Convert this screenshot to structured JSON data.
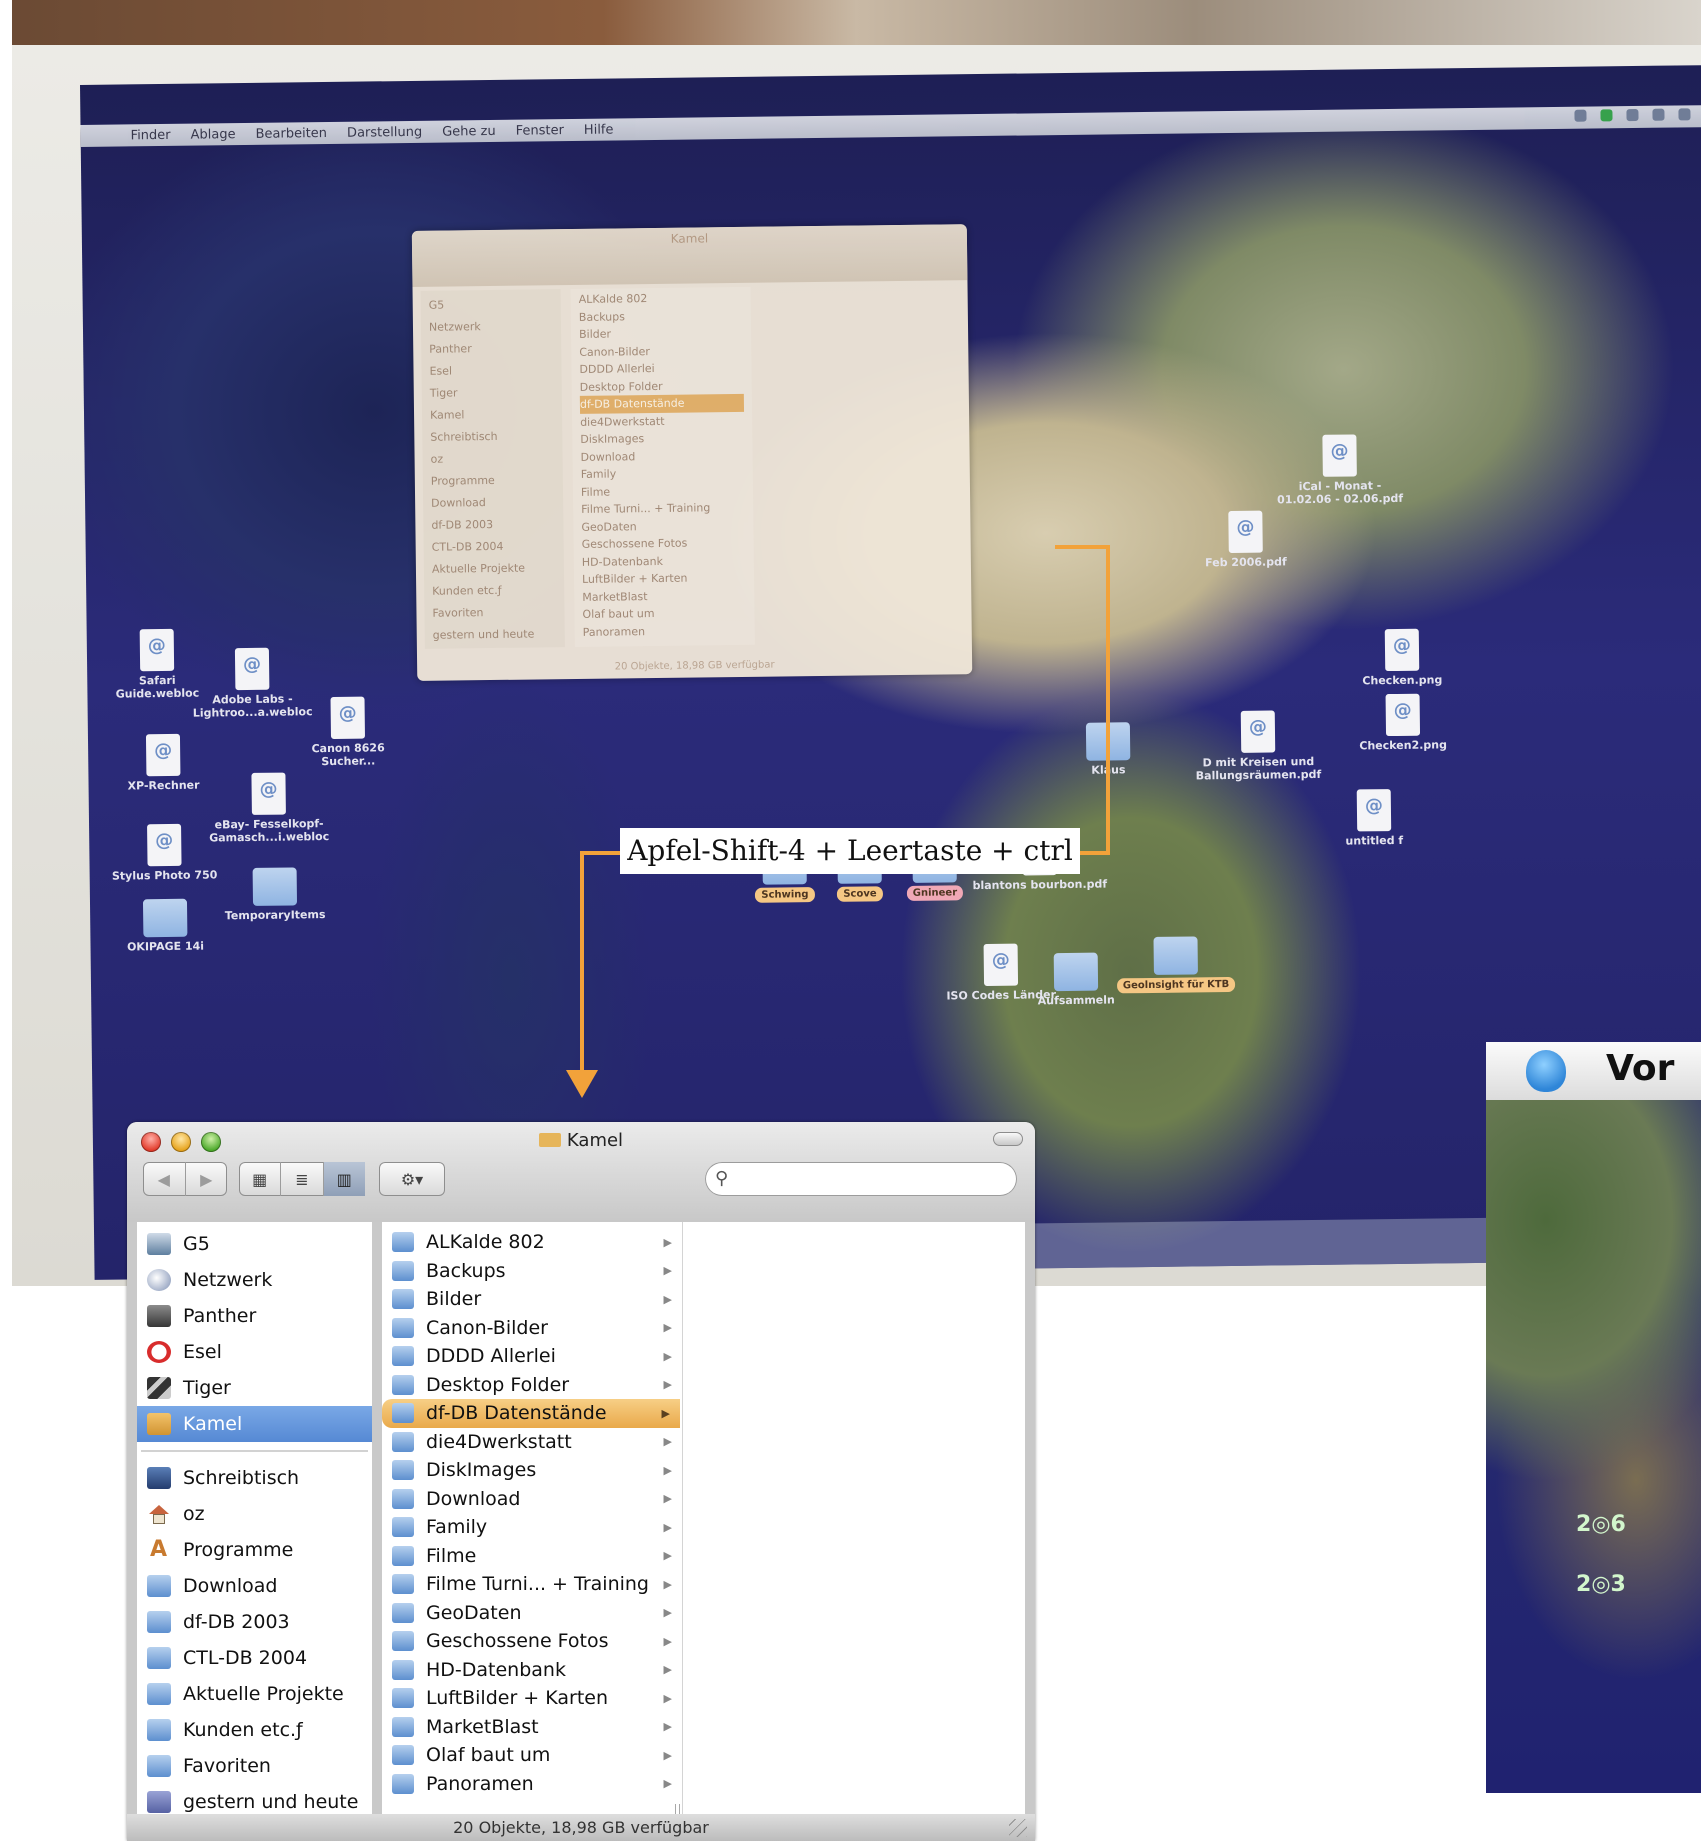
{
  "photo": {
    "menubar": [
      "Finder",
      "Ablage",
      "Bearbeiten",
      "Darstellung",
      "Gehe zu",
      "Fenster",
      "Hilfe"
    ],
    "faint_window_title": "Kamel",
    "faint_status": "20 Objekte, 18,98 GB verfügbar",
    "desktop_icons": [
      {
        "label": "Safari Guide.webloc"
      },
      {
        "label": "Adobe Labs - Lightroo...a.webloc"
      },
      {
        "label": "XP-Rechner"
      },
      {
        "label": "eBay- Fesselkopf-Gamasch...i.webloc"
      },
      {
        "label": "Stylus Photo 750"
      },
      {
        "label": "TemporaryItems"
      },
      {
        "label": "OKIPAGE 14i"
      },
      {
        "label": "Canon 8626 Sucher..."
      },
      {
        "label": "Klaus"
      },
      {
        "label": "blantons bourbon.pdf"
      },
      {
        "label": "Feb 2006.pdf"
      },
      {
        "label": "iCal - Monat - 01.02.06 - 02.06.pdf"
      },
      {
        "label": "Checken.png"
      },
      {
        "label": "Checken2.png"
      },
      {
        "label": "D mit Kreisen und Ballungsräumen.pdf"
      },
      {
        "label": "untitled f"
      },
      {
        "label": "ISO Codes Länder"
      },
      {
        "label": "Aufsammeln"
      },
      {
        "label": "Geolnsight für KTB"
      }
    ],
    "folder_tags": [
      "Schwing",
      "Scove",
      "Gnineer"
    ]
  },
  "annotation": {
    "caption": "Apfel-Shift-4 + Leertaste + ctrl"
  },
  "finder": {
    "title": "Kamel",
    "sidebar_devices": [
      {
        "label": "G5",
        "icon": "computer-icon"
      },
      {
        "label": "Netzwerk",
        "icon": "network-icon"
      },
      {
        "label": "Panther",
        "icon": "hard-disk-icon"
      },
      {
        "label": "Esel",
        "icon": "no-sign-icon"
      },
      {
        "label": "Tiger",
        "icon": "disk-image-icon"
      },
      {
        "label": "Kamel",
        "icon": "disk-icon",
        "selected": true
      }
    ],
    "sidebar_places": [
      {
        "label": "Schreibtisch",
        "icon": "desktop-icon"
      },
      {
        "label": "oz",
        "icon": "home-icon"
      },
      {
        "label": "Programme",
        "icon": "applications-icon"
      },
      {
        "label": "Download",
        "icon": "folder-icon"
      },
      {
        "label": "df-DB 2003",
        "icon": "folder-icon"
      },
      {
        "label": "CTL-DB 2004",
        "icon": "folder-icon"
      },
      {
        "label": "Aktuelle Projekte",
        "icon": "folder-icon"
      },
      {
        "label": "Kunden etc.ƒ",
        "icon": "folder-icon"
      },
      {
        "label": "Favoriten",
        "icon": "folder-icon"
      },
      {
        "label": "gestern und heute",
        "icon": "smart-folder-icon"
      }
    ],
    "column_items": [
      "ALKalde 802",
      "Backups",
      "Bilder",
      "Canon-Bilder",
      "DDDD Allerlei",
      "Desktop Folder",
      "df-DB Datenstände",
      "die4Dwerkstatt",
      "DiskImages",
      "Download",
      "Family",
      "Filme",
      "Filme Turni... + Training",
      "GeoDaten",
      "Geschossene Fotos",
      "HD-Datenbank",
      "LuftBilder + Karten",
      "MarketBlast",
      "Olaf baut um",
      "Panoramen"
    ],
    "selected_column_item": "df-DB Datenstände",
    "status": "20 Objekte, 18,98 GB verfügbar"
  },
  "overlay": {
    "title_fragment": "Vor",
    "marker_labels": [
      "2",
      "6",
      "2",
      "3"
    ]
  },
  "colors": {
    "selection_blue": "#5689d4",
    "selection_orange": "#e9a94a",
    "annotation_arrow": "#f2a23a"
  }
}
